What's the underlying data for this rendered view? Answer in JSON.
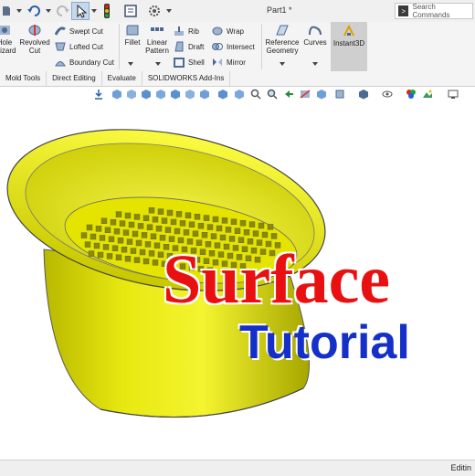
{
  "window": {
    "title": "Part1 *",
    "search_placeholder": "Search Commands"
  },
  "ribbon": {
    "hole_wizard": "Hole Wizard",
    "revolved_cut": "Revolved Cut",
    "swept_cut": "Swept Cut",
    "lofted_cut": "Lofted Cut",
    "boundary_cut": "Boundary Cut",
    "fillet": "Fillet",
    "linear_pattern": "Linear Pattern",
    "rib": "Rib",
    "draft": "Draft",
    "shell": "Shell",
    "wrap": "Wrap",
    "intersect": "Intersect",
    "mirror": "Mirror",
    "reference_geometry": "Reference Geometry",
    "curves": "Curves",
    "instant3d": "Instant3D"
  },
  "tabs": [
    "Mold Tools",
    "Direct Editing",
    "Evaluate",
    "SOLIDWORKS Add-Ins"
  ],
  "overlay": {
    "line1": "Surface",
    "line2": "Tutorial"
  },
  "status": {
    "text": "Editin"
  },
  "colors": {
    "part_yellow": "#e6e600",
    "title_red": "#e81010",
    "title_blue": "#1430c8",
    "ribbon_bg": "#f4f4f4"
  }
}
